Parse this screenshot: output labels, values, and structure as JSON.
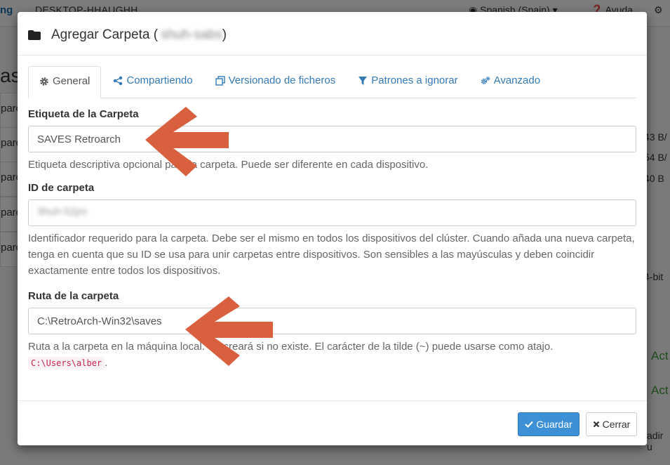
{
  "background": {
    "brand": "ng",
    "hostname": "DESKTOP-HHAUGHH",
    "language": "Spanish (Spain)",
    "help": "Ayuda",
    "heading": "as",
    "rows": [
      "parc",
      "parc",
      "parc",
      "parc",
      "parc"
    ],
    "right_values": [
      "43 B/",
      "54 B/",
      "40 B",
      "4-bit"
    ],
    "right_green": [
      "Act",
      "Act"
    ],
    "right_footer": "adir u"
  },
  "modal": {
    "title": "Agregar Carpeta (",
    "title_blurred": "shuh-sabs",
    "title_close": ")",
    "tabs": [
      {
        "label": "General",
        "icon": "gear-icon",
        "active": true
      },
      {
        "label": "Compartiendo",
        "icon": "share-icon",
        "active": false
      },
      {
        "label": "Versionado de ficheros",
        "icon": "copy-icon",
        "active": false
      },
      {
        "label": "Patrones a ignorar",
        "icon": "filter-icon",
        "active": false
      },
      {
        "label": "Avanzado",
        "icon": "cogs-icon",
        "active": false
      }
    ],
    "folder_label": {
      "label": "Etiqueta de la Carpeta",
      "value": "SAVES Retroarch",
      "help": "Etiqueta descriptiva opcional para la carpeta. Puede ser diferente en cada dispositivo."
    },
    "folder_id": {
      "label": "ID de carpeta",
      "value": "3huh-52jm",
      "help": "Identificador requerido para la carpeta. Debe ser el mismo en todos los dispositivos del clúster. Cuando añada una nueva carpeta, tenga en cuenta que su ID se usa para unir carpetas entre dispositivos. Son sensibles a las mayúsculas y deben coincidir exactamente entre todos los dispositivos."
    },
    "folder_path": {
      "label": "Ruta de la carpeta",
      "value": "C:\\RetroArch-Win32\\saves",
      "help": "Ruta a la carpeta en la máquina local. Se creará si no existe. El carácter de la tilde (~) puede usarse como atajo.",
      "help_code": "C:\\Users\\alber",
      "help_end": "."
    },
    "save_button": "Guardar",
    "close_button": "Cerrar"
  },
  "colors": {
    "arrow": "#d9603f",
    "primary": "#3d8fd6",
    "link": "#337ab7"
  }
}
